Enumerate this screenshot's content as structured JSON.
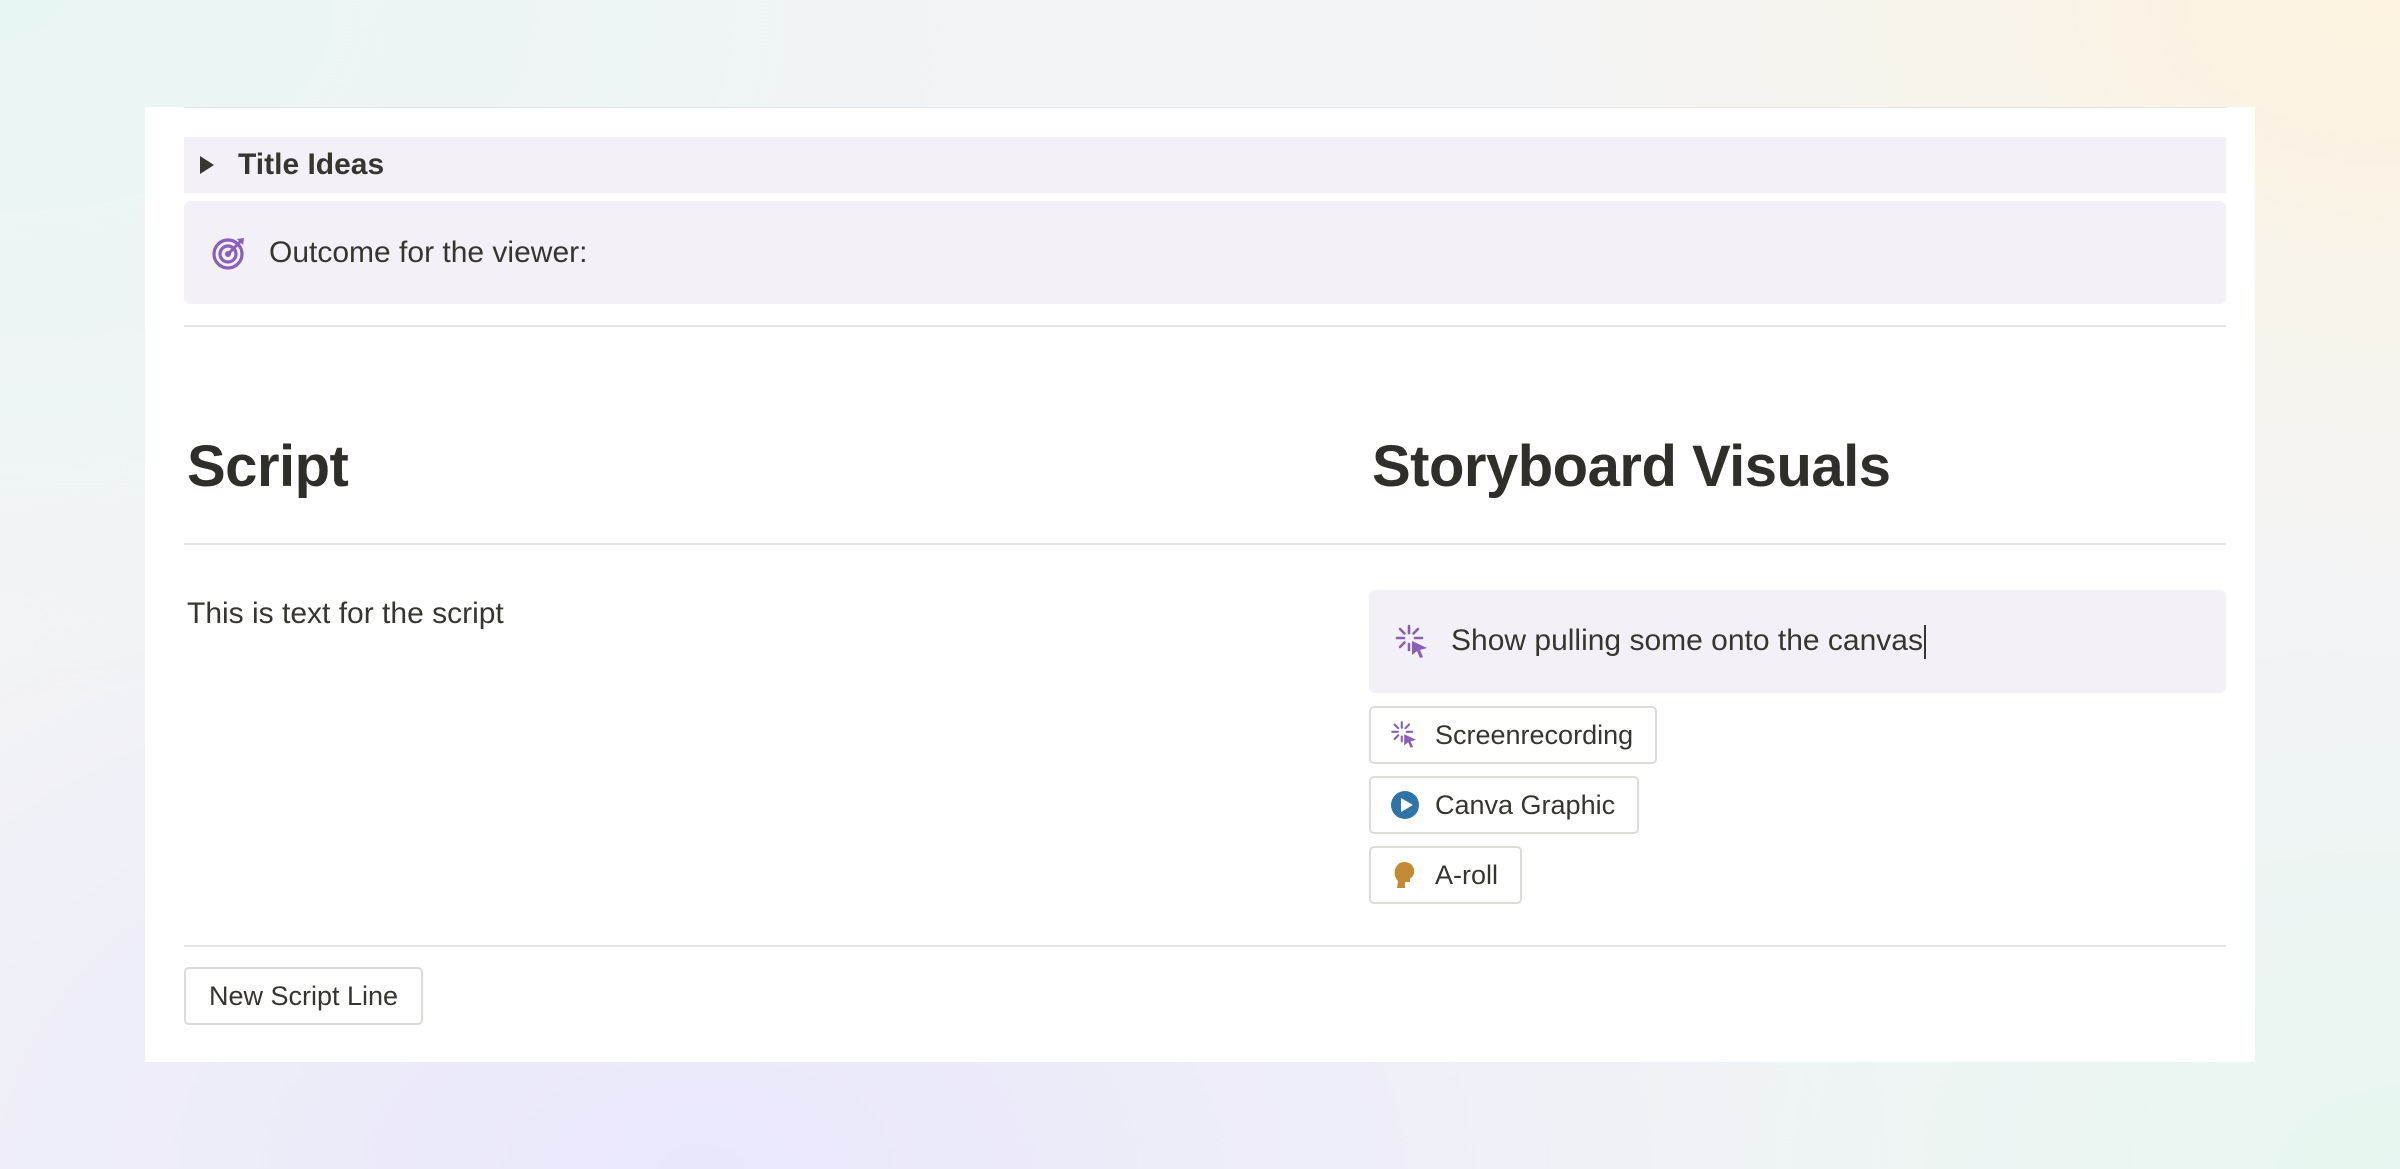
{
  "toggle": {
    "title": "Title Ideas"
  },
  "callout": {
    "text": "Outcome for the viewer:",
    "icon": "target-icon",
    "icon_color": "#8a5fb8"
  },
  "columns": {
    "script_heading": "Script",
    "visuals_heading": "Storyboard Visuals"
  },
  "script": {
    "text": "This is text for the script"
  },
  "visuals": {
    "callout_text": "Show pulling some onto the canvas",
    "callout_icon": "cursor-click-icon",
    "tags": [
      {
        "label": "Screenrecording",
        "icon": "cursor-click-icon",
        "color": "#8a5fb8"
      },
      {
        "label": "Canva Graphic",
        "icon": "play-circle-icon",
        "color": "#2e74a8"
      },
      {
        "label": "A-roll",
        "icon": "person-head-icon",
        "color": "#c28a32"
      }
    ]
  },
  "actions": {
    "new_script_line": "New Script Line"
  }
}
